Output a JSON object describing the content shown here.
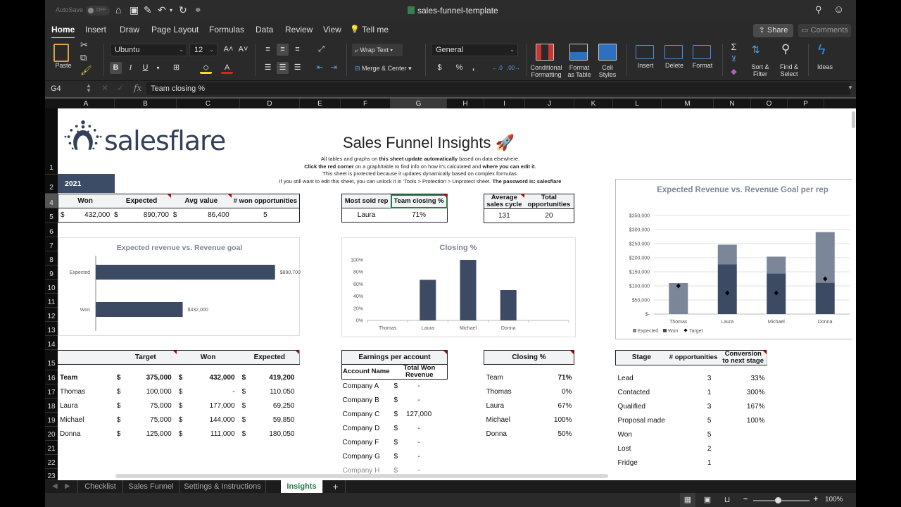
{
  "titlebar": {
    "autosave_label": "AutoSave",
    "autosave_state": "OFF",
    "document_title": "sales-funnel-template"
  },
  "menu_tabs": [
    "Home",
    "Insert",
    "Draw",
    "Page Layout",
    "Formulas",
    "Data",
    "Review",
    "View",
    "Tell me"
  ],
  "active_menu_tab": "Home",
  "share_label": "Share",
  "comments_label": "Comments",
  "ribbon": {
    "paste": "Paste",
    "font_name": "Ubuntu",
    "font_size": "12",
    "bold": "B",
    "italic": "I",
    "underline": "U",
    "wrap_text": "Wrap Text",
    "merge_center": "Merge & Center",
    "number_format": "General",
    "conditional_formatting": [
      "Conditional",
      "Formatting"
    ],
    "format_as_table": [
      "Format",
      "as Table"
    ],
    "cell_styles": [
      "Cell",
      "Styles"
    ],
    "insert": "Insert",
    "delete": "Delete",
    "format": "Format",
    "sort_filter": [
      "Sort &",
      "Filter"
    ],
    "find_select": [
      "Find &",
      "Select"
    ],
    "ideas": "Ideas"
  },
  "formula_bar": {
    "name_box": "G4",
    "fx": "fx",
    "content": "Team closing %"
  },
  "columns": [
    "A",
    "B",
    "C",
    "D",
    "E",
    "F",
    "G",
    "H",
    "I",
    "J",
    "K",
    "L",
    "M",
    "N",
    "O",
    "P"
  ],
  "selected_column": "G",
  "rows": [
    "1",
    "2",
    "4",
    "5",
    "6",
    "7",
    "8",
    "9",
    "10",
    "11",
    "12",
    "13",
    "14",
    "15",
    "16",
    "17",
    "18",
    "19",
    "20",
    "21",
    "22",
    "23"
  ],
  "selected_row": "4",
  "sheet": {
    "logo_text": "salesflare",
    "title": "Sales Funnel Insights 🚀",
    "intro": [
      [
        "All tables and graphs on ",
        "this sheet update automatically",
        " based on data elsewhere."
      ],
      [
        "Click the red corner",
        " on a graph/table to find info on how it's calculated and ",
        "where you can edit it",
        "."
      ],
      [
        "This sheet is protected because it updates dynamically based on complex formulas."
      ],
      [
        "If you still want to edit this sheet, you can unlock it in 'Tools > Protection > Unprotect sheet. ",
        "The password is: salesflare"
      ]
    ],
    "year": "2021",
    "summary": {
      "headers": [
        "Won",
        "Expected",
        "Avg value",
        "# won opportunities"
      ],
      "currency": "$",
      "values": [
        "432,000",
        "890,700",
        "86,400",
        "5"
      ]
    },
    "rep_summary": {
      "headers": [
        "Most sold rep",
        "Team closing %"
      ],
      "values": [
        "Laura",
        "71%"
      ]
    },
    "cycle_summary": {
      "headers": [
        "Average sales cycle",
        "Total opportunities"
      ],
      "values": [
        "131",
        "20"
      ]
    },
    "targets_table": {
      "headers": [
        "",
        "Target",
        "Won",
        "Expected"
      ],
      "rows": [
        {
          "name": "Team",
          "target": "375,000",
          "won": "432,000",
          "expected": "419,200"
        },
        {
          "name": "Thomas",
          "target": "100,000",
          "won": "-",
          "expected": "110,050"
        },
        {
          "name": "Laura",
          "target": "75,000",
          "won": "177,000",
          "expected": "69,250"
        },
        {
          "name": "Michael",
          "target": "75,000",
          "won": "144,000",
          "expected": "59,850"
        },
        {
          "name": "Donna",
          "target": "125,000",
          "won": "111,000",
          "expected": "180,050"
        }
      ]
    },
    "earnings_table": {
      "title": "Earnings per account",
      "headers": [
        "Account Name",
        "Total Won Revenue"
      ],
      "rows": [
        {
          "name": "Company A",
          "value": "-"
        },
        {
          "name": "Company B",
          "value": "-"
        },
        {
          "name": "Company C",
          "value": "127,000"
        },
        {
          "name": "Company D",
          "value": "-"
        },
        {
          "name": "Company F",
          "value": "-"
        },
        {
          "name": "Company G",
          "value": "-"
        },
        {
          "name": "Company H",
          "value": "-"
        }
      ]
    },
    "closing_table": {
      "title": "Closing %",
      "rows": [
        {
          "name": "Team",
          "value": "71%"
        },
        {
          "name": "Thomas",
          "value": "0%"
        },
        {
          "name": "Laura",
          "value": "67%"
        },
        {
          "name": "Michael",
          "value": "100%"
        },
        {
          "name": "Donna",
          "value": "50%"
        }
      ]
    },
    "stage_table": {
      "headers": [
        "Stage",
        "# opportunities",
        "Conversion to next stage"
      ],
      "rows": [
        {
          "stage": "Lead",
          "count": "3",
          "conv": "33%"
        },
        {
          "stage": "Contacted",
          "count": "1",
          "conv": "300%"
        },
        {
          "stage": "Qualified",
          "count": "3",
          "conv": "167%"
        },
        {
          "stage": "Proposal made",
          "count": "5",
          "conv": "100%"
        },
        {
          "stage": "Won",
          "count": "5",
          "conv": ""
        },
        {
          "stage": "Lost",
          "count": "2",
          "conv": ""
        },
        {
          "stage": "Fridge",
          "count": "1",
          "conv": ""
        }
      ]
    }
  },
  "colors": {
    "bar_dark": "#3c4b63",
    "bar_light": "#7c8699",
    "accent_green": "#2d7a4e",
    "red_corner": "#cc0000"
  },
  "chart_data": [
    {
      "type": "bar",
      "orientation": "horizontal",
      "title": "Expected revenue vs. Revenue goal",
      "categories": [
        "Expected",
        "Won"
      ],
      "values": [
        890700,
        432000
      ],
      "data_labels": [
        "$890,700",
        "$432,000"
      ],
      "xlim": [
        0,
        1000000
      ]
    },
    {
      "type": "bar",
      "title": "Closing %",
      "categories": [
        "Thomas",
        "Laura",
        "Michael",
        "Donna"
      ],
      "values": [
        0,
        67,
        100,
        50
      ],
      "ylim": [
        0,
        100
      ],
      "yticks": [
        "0%",
        "20%",
        "40%",
        "60%",
        "80%",
        "100%"
      ],
      "grid": false
    },
    {
      "type": "bar",
      "stacked": true,
      "title": "Expected Revenue vs. Revenue Goal per rep",
      "categories": [
        "Thomas",
        "Laura",
        "Michael",
        "Donna"
      ],
      "series": [
        {
          "name": "Won",
          "values": [
            0,
            177000,
            144000,
            111000
          ]
        },
        {
          "name": "Expected",
          "values": [
            110050,
            69250,
            59850,
            180050
          ]
        },
        {
          "name": "Target",
          "kind": "marker",
          "values": [
            100000,
            75000,
            75000,
            125000
          ]
        }
      ],
      "ylim": [
        0,
        350000
      ],
      "yticks": [
        "$-",
        "$50,000",
        "$100,000",
        "$150,000",
        "$200,000",
        "$250,000",
        "$300,000",
        "$350,000"
      ],
      "legend": [
        "Expected",
        "Won",
        "Target"
      ],
      "legend_position": "bottom-left",
      "grid": true
    }
  ],
  "sheet_tabs": [
    "Checklist",
    "Sales Funnel",
    "Settings & Instructions",
    "Insights"
  ],
  "active_sheet_tab": "Insights",
  "zoom_level": "100%"
}
